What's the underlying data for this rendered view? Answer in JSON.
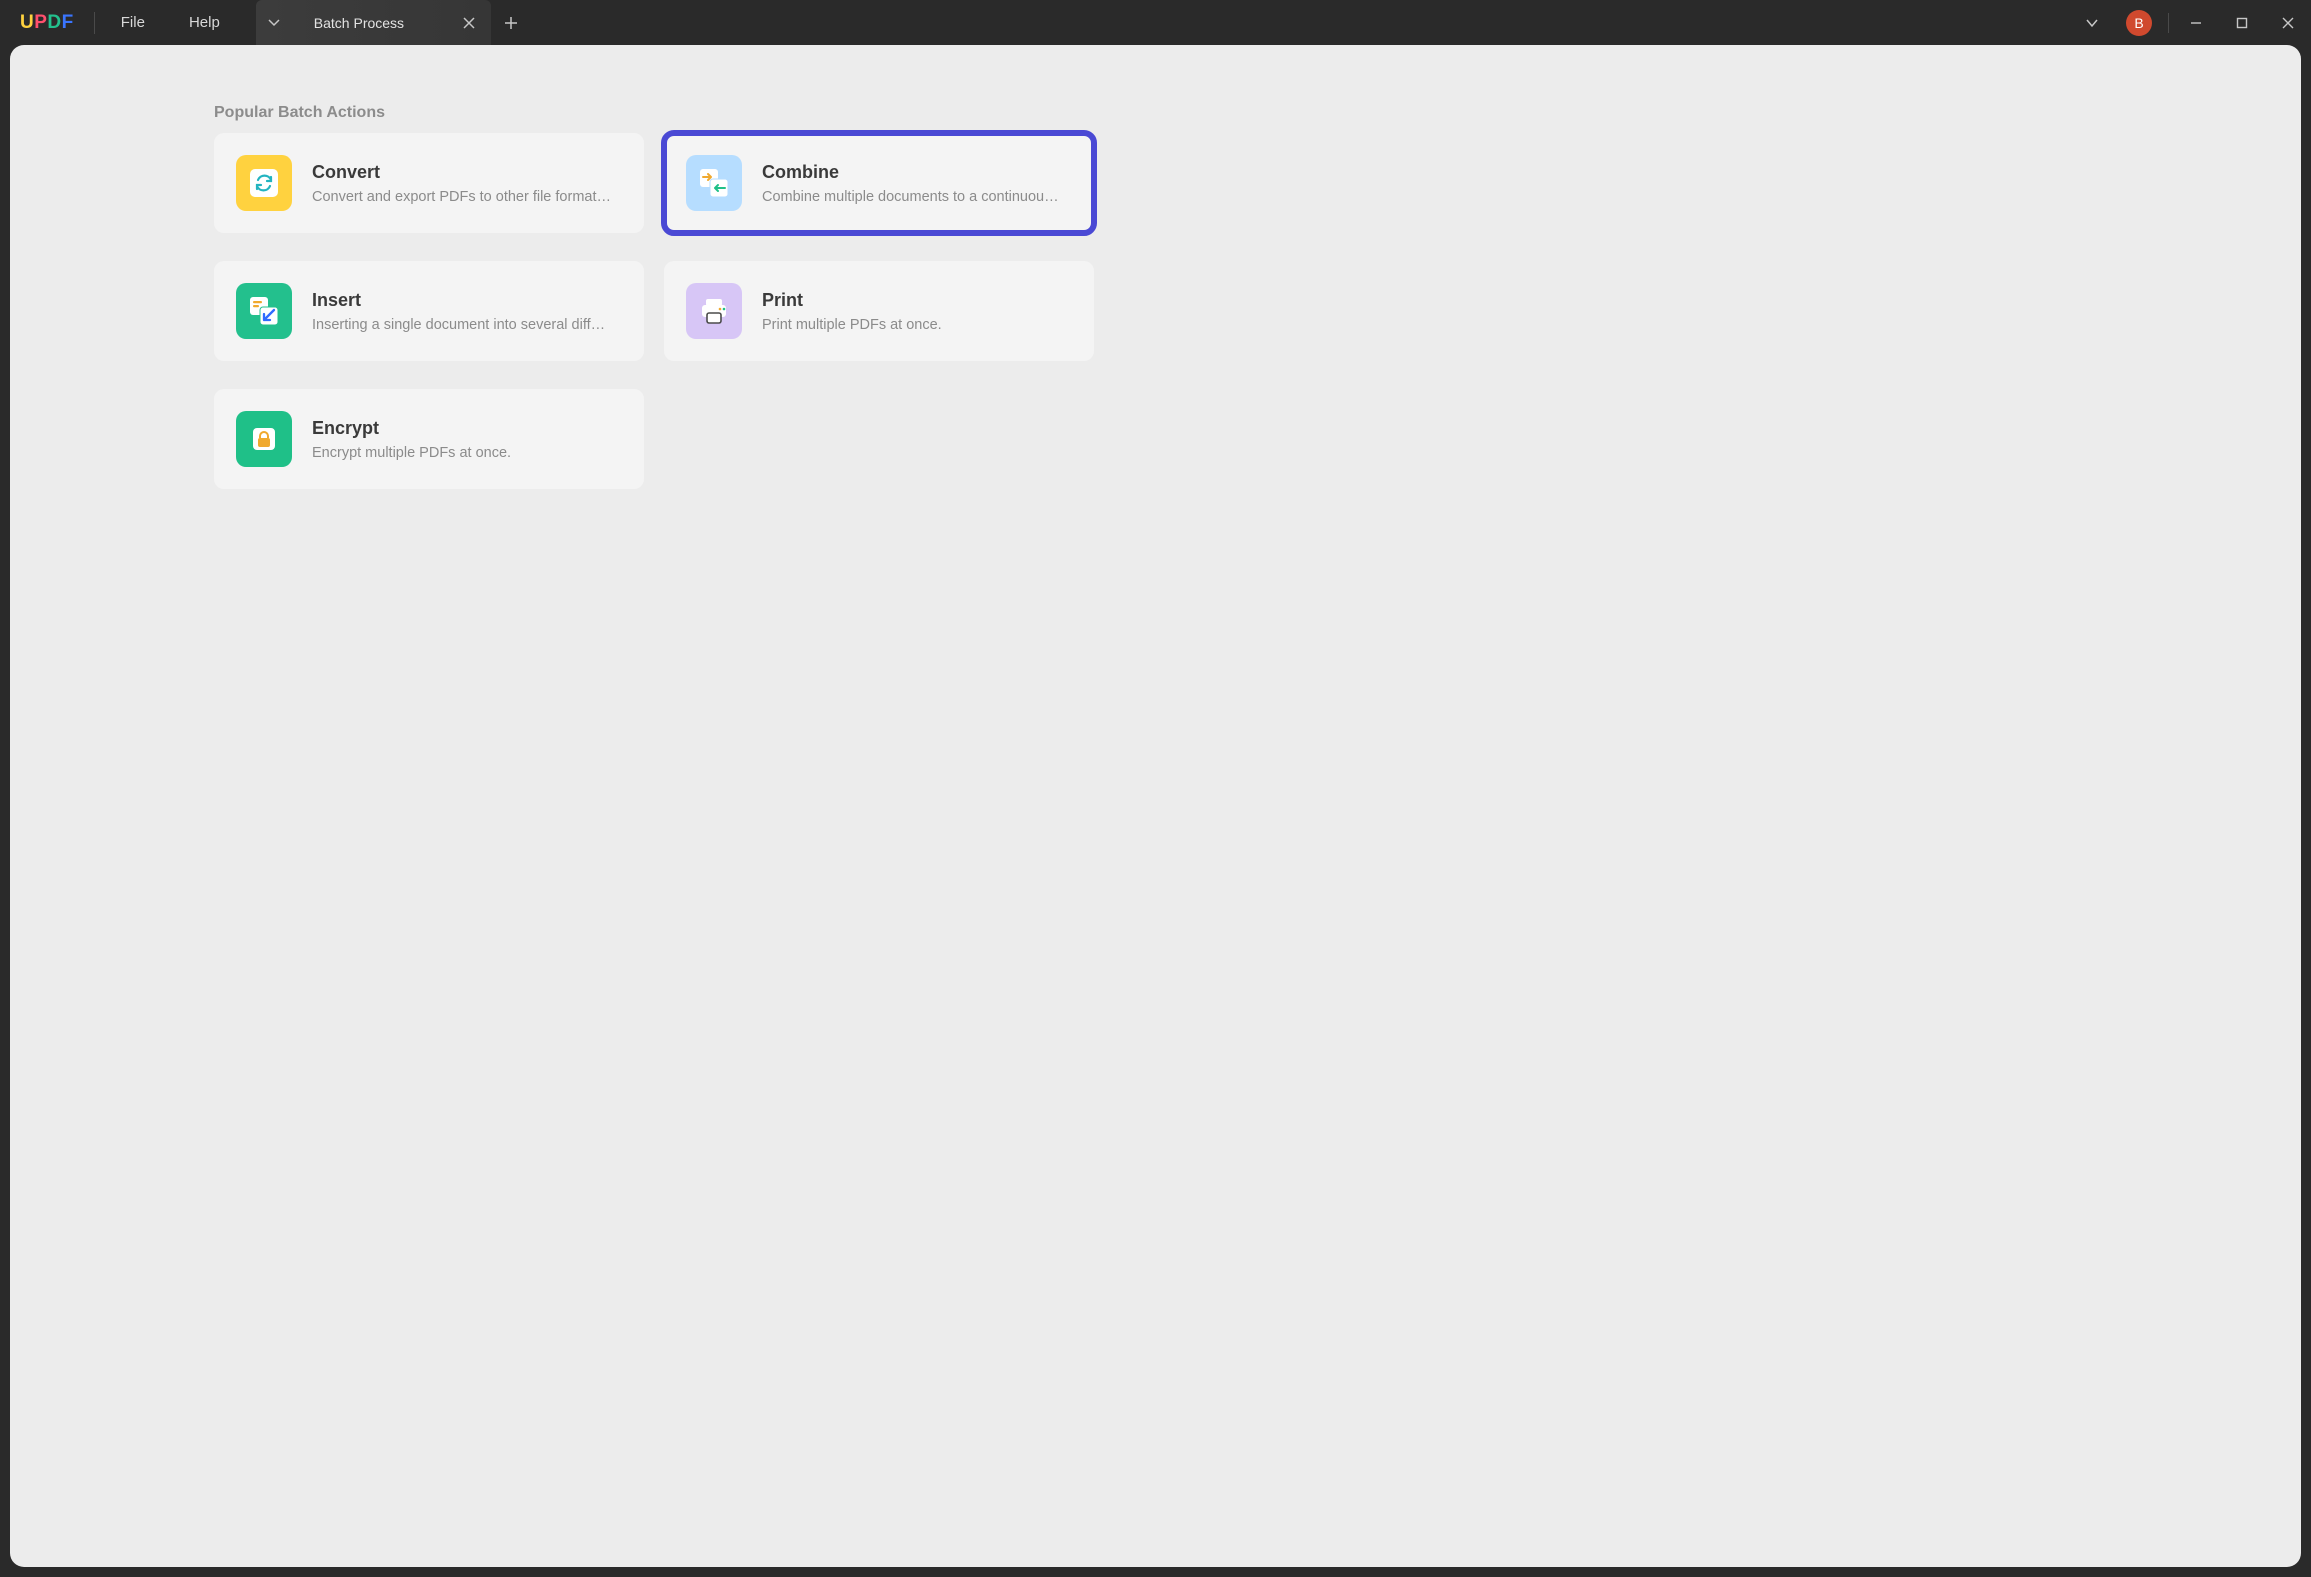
{
  "logo": {
    "letters": [
      "U",
      "P",
      "D",
      "F"
    ]
  },
  "menu": {
    "file": "File",
    "help": "Help"
  },
  "tab": {
    "label": "Batch Process"
  },
  "avatar": {
    "initial": "B"
  },
  "section_title": "Popular Batch Actions",
  "cards": {
    "convert": {
      "title": "Convert",
      "desc": "Convert and export PDFs to other file formats in batch."
    },
    "combine": {
      "title": "Combine",
      "desc": "Combine multiple documents to a continuous PDF file."
    },
    "insert": {
      "title": "Insert",
      "desc": "Inserting a single document into several different PDFs."
    },
    "print": {
      "title": "Print",
      "desc": "Print multiple PDFs at once."
    },
    "encrypt": {
      "title": "Encrypt",
      "desc": "Encrypt multiple PDFs at once."
    }
  }
}
